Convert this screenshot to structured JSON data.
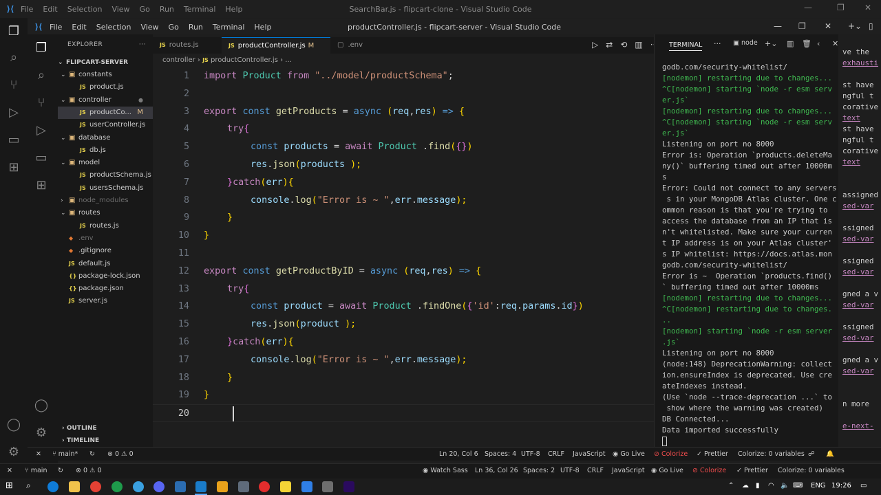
{
  "outer_window": {
    "title": "SearchBar.js - flipcart-clone - Visual Studio Code",
    "menu": [
      "File",
      "Edit",
      "Selection",
      "View",
      "Go",
      "Run",
      "Terminal",
      "Help"
    ]
  },
  "window": {
    "title": "productController.js - flipcart-server - Visual Studio Code",
    "menu": [
      "File",
      "Edit",
      "Selection",
      "View",
      "Go",
      "Run",
      "Terminal",
      "Help"
    ]
  },
  "explorer": {
    "header": "EXPLORER",
    "root": "FLIPCART-SERVER",
    "items": [
      {
        "label": "constants",
        "type": "folder",
        "depth": 1
      },
      {
        "label": "product.js",
        "type": "js",
        "depth": 2
      },
      {
        "label": "controller",
        "type": "folder",
        "depth": 1
      },
      {
        "label": "productCo...",
        "type": "js",
        "depth": 2,
        "badge": "M"
      },
      {
        "label": "userController.js",
        "type": "js",
        "depth": 2
      },
      {
        "label": "database",
        "type": "folder",
        "depth": 1
      },
      {
        "label": "db.js",
        "type": "js",
        "depth": 2
      },
      {
        "label": "model",
        "type": "folder",
        "depth": 1
      },
      {
        "label": "productSchema.js",
        "type": "js",
        "depth": 2
      },
      {
        "label": "usersSchema.js",
        "type": "js",
        "depth": 2
      },
      {
        "label": "node_modules",
        "type": "folder",
        "depth": 1
      },
      {
        "label": "routes",
        "type": "folder",
        "depth": 1
      },
      {
        "label": "routes.js",
        "type": "js",
        "depth": 2
      },
      {
        "label": ".env",
        "type": "gen",
        "depth": 1
      },
      {
        "label": ".gitignore",
        "type": "gen",
        "depth": 1
      },
      {
        "label": "default.js",
        "type": "js",
        "depth": 1
      },
      {
        "label": "package-lock.json",
        "type": "json",
        "depth": 1
      },
      {
        "label": "package.json",
        "type": "json",
        "depth": 1
      },
      {
        "label": "server.js",
        "type": "js",
        "depth": 1
      }
    ],
    "outline": "OUTLINE",
    "timeline": "TIMELINE"
  },
  "tabs": [
    {
      "label": "routes.js",
      "icon": "JS"
    },
    {
      "label": "productController.js",
      "icon": "JS",
      "modified": "M"
    },
    {
      "label": ".env",
      "icon": "file"
    }
  ],
  "breadcrumb": {
    "folder": "controller",
    "file": "productController.js",
    "more": "..."
  },
  "code_lines": [
    {
      "n": "1"
    },
    {
      "n": "2"
    },
    {
      "n": "3"
    },
    {
      "n": "4"
    },
    {
      "n": "5"
    },
    {
      "n": "6"
    },
    {
      "n": "7"
    },
    {
      "n": "8"
    },
    {
      "n": "9"
    },
    {
      "n": "10"
    },
    {
      "n": "11"
    },
    {
      "n": "12"
    },
    {
      "n": "13"
    },
    {
      "n": "14"
    },
    {
      "n": "15"
    },
    {
      "n": "16"
    },
    {
      "n": "17"
    },
    {
      "n": "18"
    },
    {
      "n": "19"
    },
    {
      "n": "20"
    }
  ],
  "code": {
    "l1": [
      "import",
      "Product",
      "from",
      "\"../model/productSchema\"",
      ";"
    ],
    "l3": [
      "export",
      "const",
      "getProducts",
      "=",
      "async",
      "(",
      "req",
      ",",
      "res",
      ")",
      "=>",
      "{"
    ],
    "l4": [
      "try",
      "{"
    ],
    "l5": [
      "const",
      "products",
      "=",
      "await",
      "Product",
      ".",
      "find",
      "(",
      "{}",
      ")"
    ],
    "l6": [
      "res",
      ".",
      "json",
      "(",
      "products",
      ");"
    ],
    "l7": [
      "}",
      "catch",
      "(",
      "err",
      "){"
    ],
    "l8": [
      "console",
      ".",
      "log",
      "(",
      "\"Error is ~ \"",
      ",",
      "err",
      ".",
      "message",
      ");"
    ],
    "l9": [
      "}"
    ],
    "l10": [
      "}"
    ],
    "l12": [
      "export",
      "const",
      "getProductByID",
      "=",
      "async",
      "(",
      "req",
      ",",
      "res",
      ")",
      "=>",
      "{"
    ],
    "l13": [
      "try",
      "{"
    ],
    "l14": [
      "const",
      "product",
      "=",
      "await",
      "Product",
      ".",
      "findOne",
      "(",
      "{",
      "'id'",
      ":",
      "req",
      ".",
      "params",
      ".",
      "id",
      "}",
      ")"
    ],
    "l15": [
      "res",
      ".",
      "json",
      "(",
      "product",
      ");"
    ],
    "l16": [
      "}",
      "catch",
      "(",
      "err",
      "){"
    ],
    "l17": [
      "console",
      ".",
      "log",
      "(",
      "\"Error is ~ \"",
      ",",
      "err",
      ".",
      "message",
      ");"
    ],
    "l18": [
      "}"
    ],
    "l19": [
      "}"
    ]
  },
  "terminal": {
    "tab_label": "TERMINAL",
    "shell": "node",
    "lines": [
      {
        "text": "godb.com/security-whitelist/",
        "color": "white"
      },
      {
        "text": "[nodemon] restarting due to changes...",
        "color": "green"
      },
      {
        "text": "^C[nodemon] starting `node -r esm serv",
        "color": "green"
      },
      {
        "text": "er.js`",
        "color": "green"
      },
      {
        "text": "[nodemon] restarting due to changes...",
        "color": "green"
      },
      {
        "text": "^C[nodemon] starting `node -r esm serv",
        "color": "green"
      },
      {
        "text": "er.js`",
        "color": "green"
      },
      {
        "text": "Listening on port no 8000",
        "color": "white"
      },
      {
        "text": "Error is: Operation `products.deleteMa",
        "color": "white"
      },
      {
        "text": "ny()` buffering timed out after 10000m",
        "color": "white"
      },
      {
        "text": "s",
        "color": "white"
      },
      {
        "text": "Error: Could not connect to any servers",
        "color": "white"
      },
      {
        "text": " s in your MongoDB Atlas cluster. One c",
        "color": "white"
      },
      {
        "text": "ommon reason is that you're trying to",
        "color": "white"
      },
      {
        "text": "access the database from an IP that is",
        "color": "white"
      },
      {
        "text": "n't whitelisted. Make sure your curren",
        "color": "white"
      },
      {
        "text": "t IP address is on your Atlas cluster'",
        "color": "white"
      },
      {
        "text": "s IP whitelist: https://docs.atlas.mon",
        "color": "white"
      },
      {
        "text": "godb.com/security-whitelist/",
        "color": "white"
      },
      {
        "text": "Error is ~  Operation `products.find()",
        "color": "white"
      },
      {
        "text": "` buffering timed out after 10000ms",
        "color": "white"
      },
      {
        "text": "[nodemon] restarting due to changes...",
        "color": "green"
      },
      {
        "text": "^C[nodemon] restarting due to changes.",
        "color": "green"
      },
      {
        "text": "..",
        "color": "green"
      },
      {
        "text": "[nodemon] starting `node -r esm server",
        "color": "green"
      },
      {
        "text": ".js`",
        "color": "green"
      },
      {
        "text": "Listening on port no 8000",
        "color": "white"
      },
      {
        "text": "(node:148) DeprecationWarning: collect",
        "color": "white"
      },
      {
        "text": "ion.ensureIndex is deprecated. Use cre",
        "color": "white"
      },
      {
        "text": "ateIndexes instead.",
        "color": "white"
      },
      {
        "text": "(Use `node --trace-deprecation ...` to",
        "color": "white"
      },
      {
        "text": " show where the warning was created)",
        "color": "white"
      },
      {
        "text": "DB Connected...",
        "color": "white"
      },
      {
        "text": "Data imported successfully",
        "color": "white"
      }
    ]
  },
  "bg_right": [
    {
      "text": "ve the",
      "link": false
    },
    {
      "text": "exhausti",
      "link": true
    },
    {
      "text": "st have",
      "link": false
    },
    {
      "text": "ngful t",
      "link": false
    },
    {
      "text": "corative",
      "link": false
    },
    {
      "text": "text",
      "link": true
    },
    {
      "text": "st have",
      "link": false
    },
    {
      "text": "ngful t",
      "link": false
    },
    {
      "text": "corative",
      "link": false
    },
    {
      "text": "text",
      "link": true
    },
    {
      "text": "assigned",
      "link": false
    },
    {
      "text": "sed-var",
      "link": true
    },
    {
      "text": "ssigned",
      "link": false
    },
    {
      "text": "sed-var",
      "link": true
    },
    {
      "text": "ssigned",
      "link": false
    },
    {
      "text": "sed-var",
      "link": true
    },
    {
      "text": "gned a v",
      "link": false
    },
    {
      "text": "sed-var",
      "link": true
    },
    {
      "text": "ssigned",
      "link": false
    },
    {
      "text": "sed-var",
      "link": true
    },
    {
      "text": "gned a v",
      "link": false
    },
    {
      "text": "sed-var",
      "link": true
    },
    {
      "text": "n more",
      "link": false
    },
    {
      "text": "e-next-",
      "link": true
    }
  ],
  "statusbar": {
    "branch": "main*",
    "sync": "↻",
    "problems": "⊗ 0 ⚠ 0",
    "position": "Ln 20, Col 6",
    "spaces": "Spaces: 4",
    "encoding": "UTF-8",
    "eol": "CRLF",
    "language": "JavaScript",
    "golive": "Go Live",
    "colorize": "Colorize",
    "prettier": "Prettier",
    "colorize_vars": "Colorize: 0 variables"
  },
  "outer_statusbar": {
    "branch": "main",
    "problems": "⊗ 0 ⚠ 0",
    "watch": "Watch Sass",
    "position": "Ln 36, Col 26",
    "spaces": "Spaces: 2",
    "encoding": "UTF-8",
    "eol": "CRLF",
    "language": "JavaScript",
    "golive": "Go Live",
    "colorize": "Colorize",
    "prettier": "Prettier",
    "colorize_vars": "Colorize: 0 variables"
  },
  "taskbar": {
    "lang": "ENG",
    "time": "19:26"
  },
  "colors": {
    "accent": "#0078d4",
    "editor_bg": "#1e1e1e",
    "sidebar_bg": "#181818",
    "terminal_green": "#3fb950"
  }
}
